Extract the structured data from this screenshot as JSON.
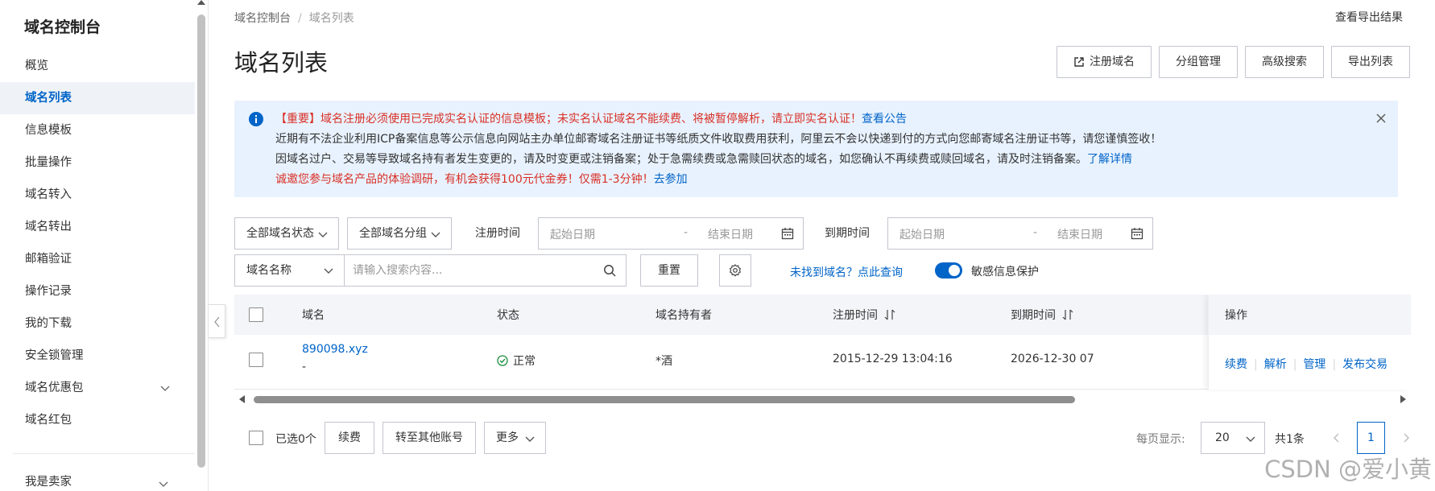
{
  "sidebar": {
    "title": "域名控制台",
    "items": [
      {
        "label": "概览"
      },
      {
        "label": "域名列表"
      },
      {
        "label": "信息模板"
      },
      {
        "label": "批量操作"
      },
      {
        "label": "域名转入"
      },
      {
        "label": "域名转出"
      },
      {
        "label": "邮箱验证"
      },
      {
        "label": "操作记录"
      },
      {
        "label": "我的下载"
      },
      {
        "label": "安全锁管理"
      },
      {
        "label": "域名优惠包"
      },
      {
        "label": "域名红包"
      }
    ],
    "active_item": "域名列表",
    "seller_label": "我是卖家"
  },
  "breadcrumb": {
    "root": "域名控制台",
    "sep": "/",
    "current": "域名列表"
  },
  "header": {
    "export_result_link": "查看导出结果",
    "page_title": "域名列表",
    "buttons": {
      "register": "注册域名",
      "group_manage": "分组管理",
      "advanced_search": "高级搜索",
      "export_list": "导出列表"
    }
  },
  "notice": {
    "line1_red": "【重要】域名注册必须使用已完成实名认证的信息模板；未实名认证域名不能续费、将被暂停解析，请立即实名认证！",
    "line1_link": "查看公告",
    "line2": "近期有不法企业利用ICP备案信息等公示信息向网站主办单位邮寄域名注册证书等纸质文件收取费用获利，阿里云不会以快递到付的方式向您邮寄域名注册证书等，请您谨慎签收！",
    "line3": "因域名过户、交易等导致域名持有者发生变更的，请及时变更或注销备案；处于急需续费或急需赎回状态的域名，如您确认不再续费或赎回域名，请及时注销备案。",
    "line3_link": "了解详情",
    "line4_red": "诚邀您参与域名产品的体验调研，有机会获得100元代金券！仅需1-3分钟！",
    "line4_link": "去参加"
  },
  "filters": {
    "status_select": "全部域名状态",
    "group_select": "全部域名分组",
    "reg_time_label": "注册时间",
    "exp_time_label": "到期时间",
    "start_placeholder": "起始日期",
    "end_placeholder": "结束日期",
    "date_dash": "-",
    "search_kind": "域名名称",
    "search_placeholder": "请输入搜索内容...",
    "reset": "重置",
    "not_found_link": "未找到域名？点此查询",
    "privacy_toggle_label": "敏感信息保护",
    "privacy_toggle_on": true
  },
  "table": {
    "columns": [
      "域名",
      "状态",
      "域名持有者",
      "注册时间",
      "到期时间",
      "操作"
    ],
    "rows": [
      {
        "domain": "890098.xyz",
        "domain_sub": "-",
        "status": "正常",
        "holder": "*酒",
        "reg_time": "2015-12-29 13:04:16",
        "exp_time": "2026-12-30 07",
        "ops": [
          "续费",
          "解析",
          "管理",
          "发布交易"
        ]
      }
    ]
  },
  "footer": {
    "selected": "已选0个",
    "renew": "续费",
    "transfer": "转至其他账号",
    "more": "更多",
    "per_page_label": "每页显示:",
    "per_page_value": "20",
    "total": "共1条",
    "current_page": "1"
  },
  "watermark": "CSDN @爱小黄",
  "colors": {
    "accent": "#0064c8",
    "danger": "#d93026",
    "notice_bg": "#e8f2fe",
    "success": "#1e8e3e"
  }
}
